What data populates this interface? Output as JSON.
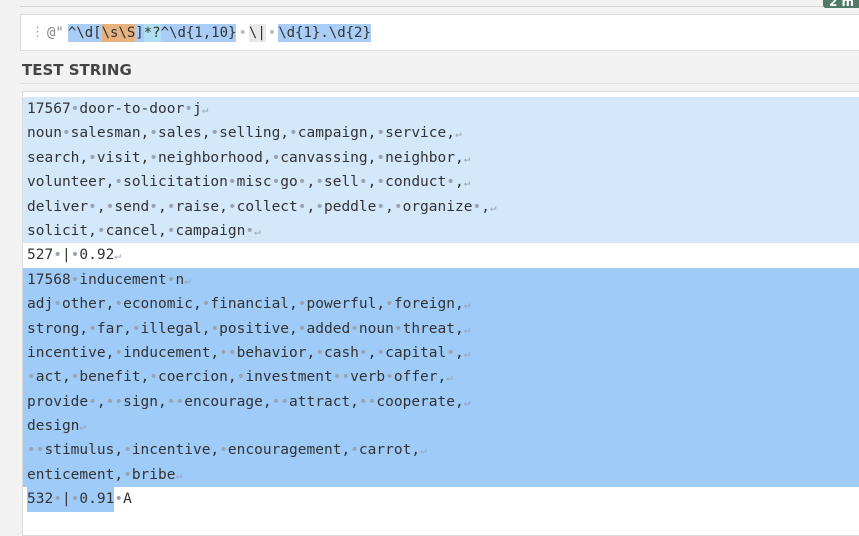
{
  "regex": {
    "delimiter": "@\"",
    "tokens": [
      {
        "text": "^\\d[",
        "kind": "anchor"
      },
      {
        "text": "\\s\\S",
        "kind": "class"
      },
      {
        "text": "]",
        "kind": "anchor"
      },
      {
        "text": "*?",
        "kind": "quant"
      },
      {
        "text": "^\\d{1,10}",
        "kind": "anchor"
      },
      {
        "text": "•",
        "kind": "sp"
      },
      {
        "text": "\\|",
        "kind": "lit"
      },
      {
        "text": "•",
        "kind": "sp"
      },
      {
        "text": "\\d{1}.\\d{2}",
        "kind": "anchor"
      }
    ]
  },
  "test_string_label": "TEST STRING",
  "corner_badge": "2 m",
  "test_lines": [
    {
      "text": "17567•door-to-door•j↵",
      "match": 1
    },
    {
      "text": "noun•salesman,•sales,•selling,•campaign,•service,↵",
      "match": 1
    },
    {
      "text": "search,•visit,•neighborhood,•canvassing,•neighbor,↵",
      "match": 1
    },
    {
      "text": "volunteer,•solicitation•misc•go•,•sell•,•conduct•,↵",
      "match": 1
    },
    {
      "text": "deliver•,•send•,•raise,•collect•,•peddle•,•organize•,↵",
      "match": 1
    },
    {
      "text": "solicit,•cancel,•campaign•↵",
      "match": 1
    },
    {
      "text": "527•|•0.92↵",
      "match": 0
    },
    {
      "text": "17568•inducement•n↵",
      "match": 2
    },
    {
      "text": "adj•other,•economic,•financial,•powerful,•foreign,↵",
      "match": 2
    },
    {
      "text": "strong,•far,•illegal,•positive,•added•noun•threat,↵",
      "match": 2
    },
    {
      "text": "incentive,•inducement,••behavior,•cash•,•capital•,↵",
      "match": 2
    },
    {
      "text": "•act,•benefit,•coercion,•investment••verb•offer,↵",
      "match": 2
    },
    {
      "text": "provide•,••sign,••encourage,••attract,••cooperate,↵",
      "match": 2
    },
    {
      "text": "design↵",
      "match": 2
    },
    {
      "text": "••stimulus,•incentive,•encouragement,•carrot,↵",
      "match": 2
    },
    {
      "text": "enticement,•bribe↵",
      "match": 2
    },
    {
      "text": "532•|•0.91",
      "match": 3,
      "tail": "•A"
    }
  ]
}
